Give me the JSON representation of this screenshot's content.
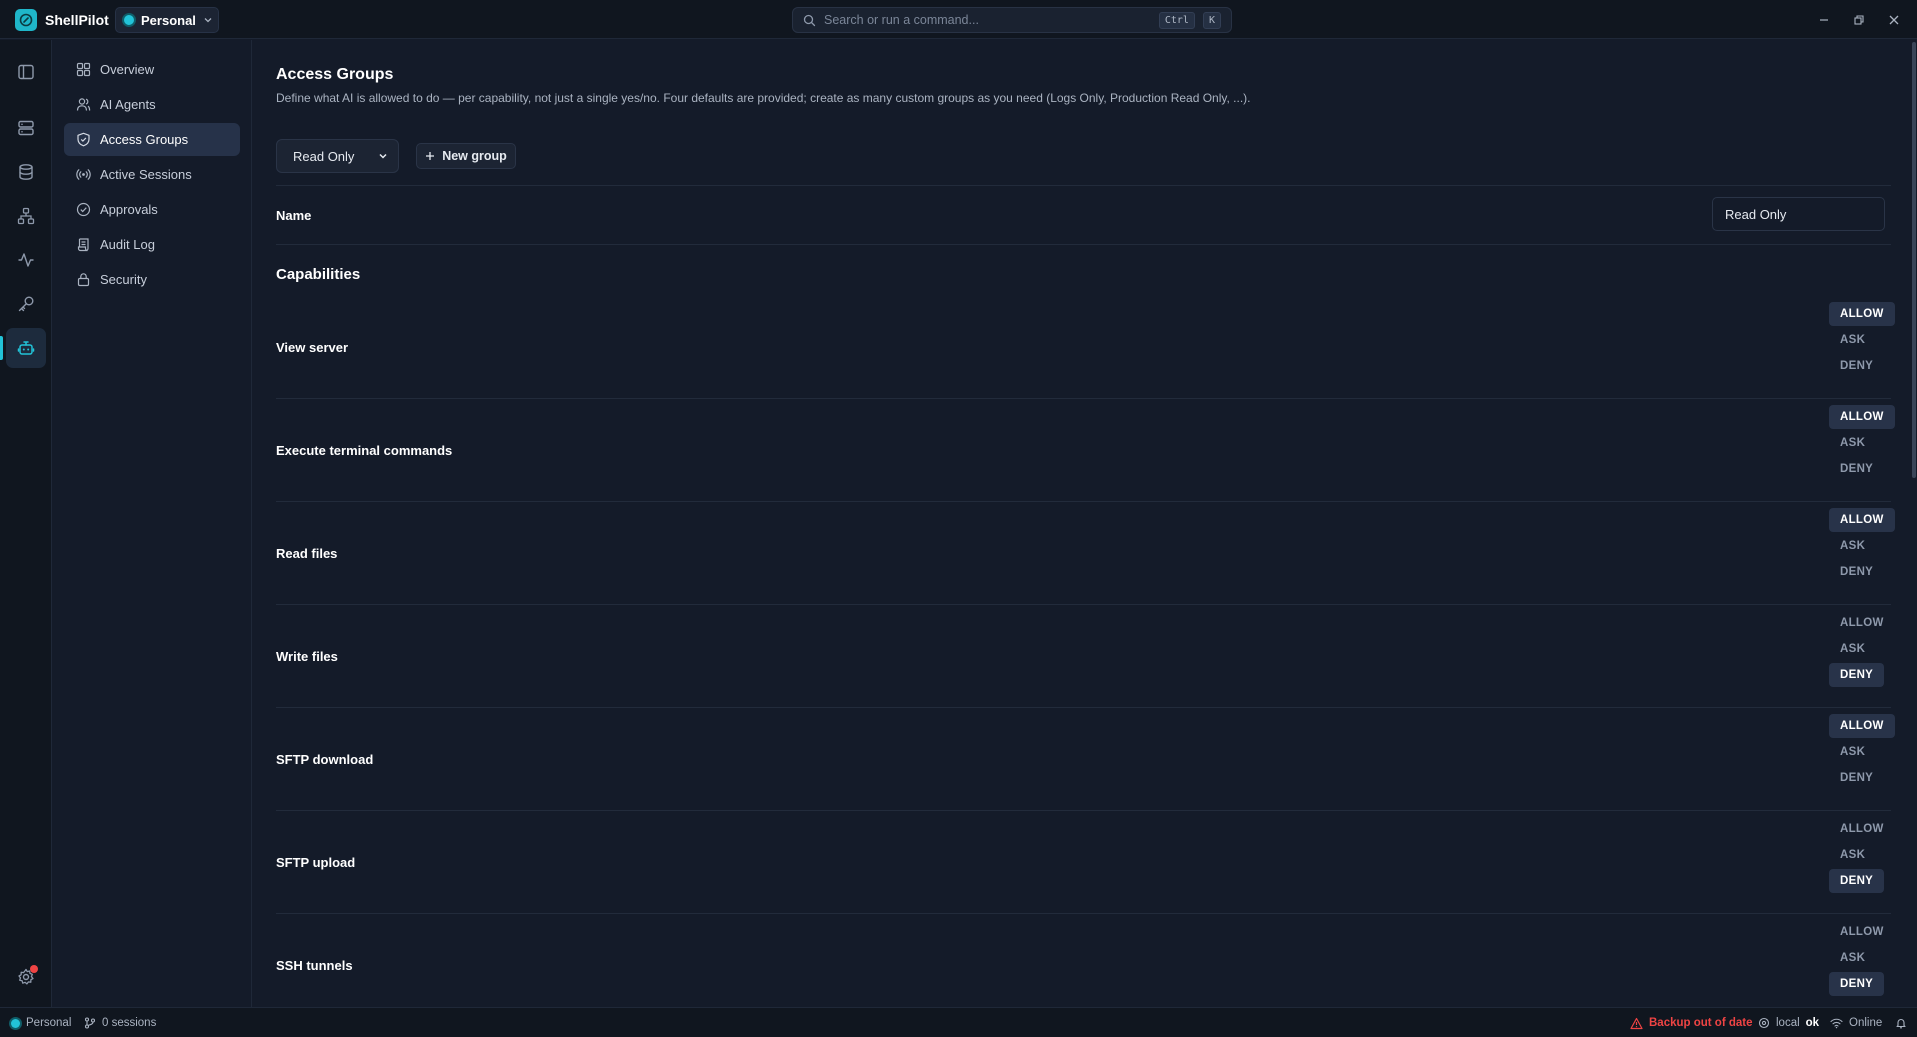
{
  "app": {
    "name": "ShellPilot",
    "workspace": "Personal",
    "search_placeholder": "Search or run a command...",
    "shortcut_key1": "Ctrl",
    "shortcut_key2": "K"
  },
  "rail": {
    "items": [
      "panel-toggle-icon",
      "servers-icon",
      "database-icon",
      "network-icon",
      "activity-icon",
      "key-icon",
      "bot-icon"
    ],
    "active": "bot-icon",
    "settings_has_notification": true
  },
  "nav": {
    "items": [
      {
        "label": "Overview",
        "icon": "grid-icon"
      },
      {
        "label": "AI Agents",
        "icon": "users-icon"
      },
      {
        "label": "Access Groups",
        "icon": "shield-icon"
      },
      {
        "label": "Active Sessions",
        "icon": "broadcast-icon"
      },
      {
        "label": "Approvals",
        "icon": "check-circle-icon"
      },
      {
        "label": "Audit Log",
        "icon": "scroll-icon"
      },
      {
        "label": "Security",
        "icon": "lock-icon"
      }
    ],
    "active_index": 2
  },
  "main": {
    "title": "Access Groups",
    "description": "Define what AI is allowed to do — per capability, not just a single yes/no. Four defaults are provided; create as many custom groups as you need (Logs Only, Production Read Only, ...).",
    "group_select_value": "Read Only",
    "new_group_label": "New group",
    "name_label": "Name",
    "name_value": "Read Only",
    "capabilities_heading": "Capabilities",
    "option_labels": {
      "allow": "ALLOW",
      "ask": "ASK",
      "deny": "DENY"
    },
    "capabilities": [
      {
        "label": "View server",
        "value": "allow"
      },
      {
        "label": "Execute terminal commands",
        "value": "allow"
      },
      {
        "label": "Read files",
        "value": "allow"
      },
      {
        "label": "Write files",
        "value": "deny"
      },
      {
        "label": "SFTP download",
        "value": "allow"
      },
      {
        "label": "SFTP upload",
        "value": "deny"
      },
      {
        "label": "SSH tunnels",
        "value": "deny"
      }
    ]
  },
  "status": {
    "workspace": "Personal",
    "sessions": "0 sessions",
    "backup_warning": "Backup out of date",
    "local_label": "local",
    "local_state": "ok",
    "connection": "Online"
  },
  "colors": {
    "accent": "#22c3d8",
    "background": "#141b29",
    "warning": "#ef4444"
  }
}
